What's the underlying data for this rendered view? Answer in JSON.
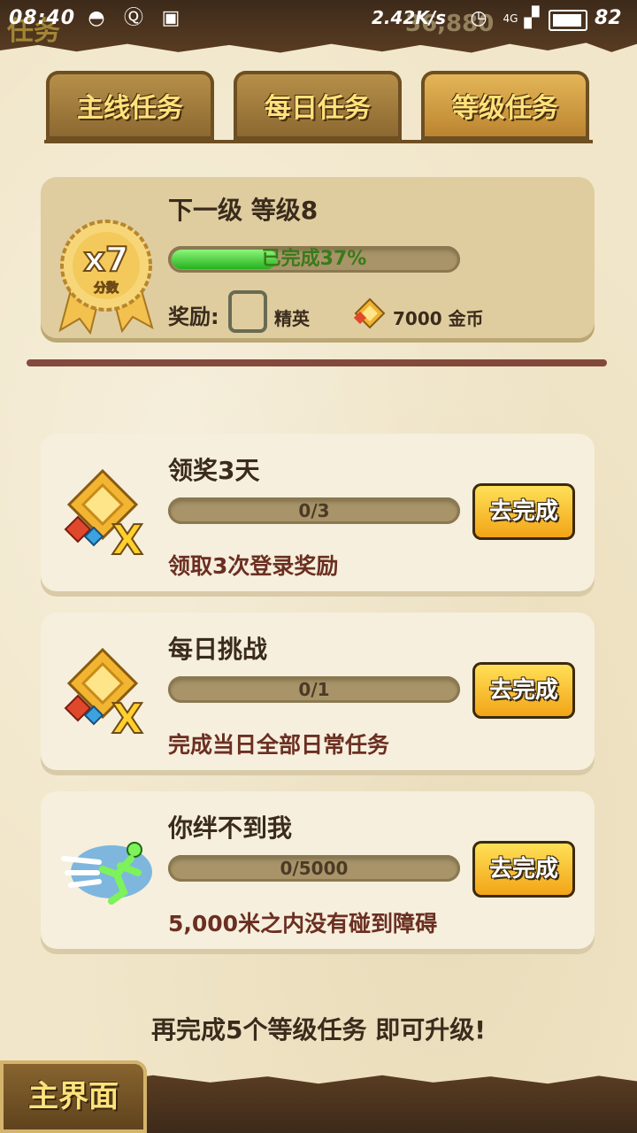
{
  "status_bar": {
    "time": "08:40",
    "speed": "2.42K/s",
    "battery": "82",
    "network": "4G"
  },
  "background": {
    "title": "任务",
    "score": "36,880"
  },
  "tabs": [
    {
      "label": "主线任务",
      "active": false
    },
    {
      "label": "每日任务",
      "active": false
    },
    {
      "label": "等级任务",
      "active": true
    }
  ],
  "level": {
    "badge_multiplier": "x7",
    "badge_label": "分数",
    "title": "下一级 等级8",
    "progress_text": "已完成37%",
    "progress": 0.37,
    "reward_label": "奖励:",
    "reward_item": "精英",
    "reward_coins": "7000 金币"
  },
  "tasks": [
    {
      "title": "领奖3天",
      "progress_text": "0/3",
      "progress": 0,
      "description": "领取3次登录奖励",
      "button": "去完成",
      "icon": "diamond-x-icon"
    },
    {
      "title": "每日挑战",
      "progress_text": "0/1",
      "progress": 0,
      "description": "完成当日全部日常任务",
      "button": "去完成",
      "icon": "diamond-x-icon"
    },
    {
      "title": "你绊不到我",
      "progress_text": "0/5000",
      "progress": 0,
      "description": "5,000米之内没有碰到障碍",
      "button": "去完成",
      "icon": "runner-icon"
    }
  ],
  "footer": "再完成5个等级任务 即可升级!",
  "home_button": "主界面"
}
